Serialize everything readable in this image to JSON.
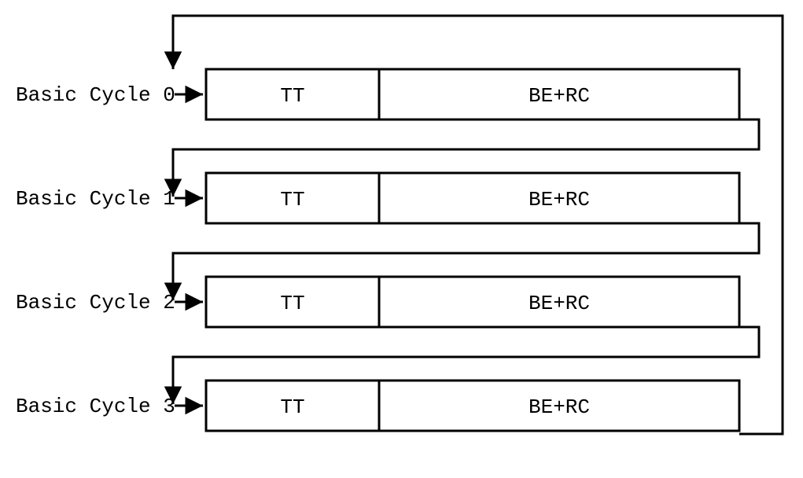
{
  "cycles": [
    {
      "label": "Basic Cycle 0",
      "left": "TT",
      "right": "BE+RC"
    },
    {
      "label": "Basic Cycle 1",
      "left": "TT",
      "right": "BE+RC"
    },
    {
      "label": "Basic Cycle 2",
      "left": "TT",
      "right": "BE+RC"
    },
    {
      "label": "Basic Cycle 3",
      "left": "TT",
      "right": "BE+RC"
    }
  ]
}
